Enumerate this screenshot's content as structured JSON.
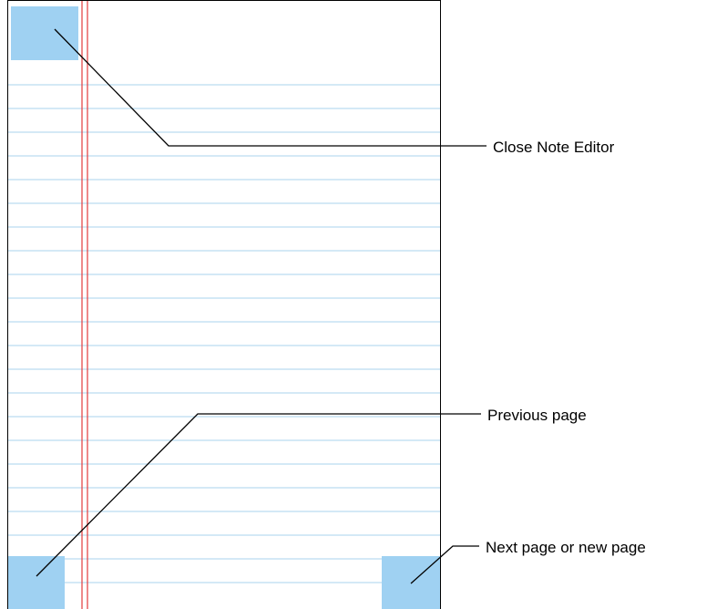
{
  "colors": {
    "page_border": "#000000",
    "rule_line": "#a9d3ee",
    "margin_line": "#e23b3b",
    "hotspot_fill": "#9fd1f2",
    "callout_line": "#000000"
  },
  "notepad": {
    "rule_count": 22
  },
  "callouts": {
    "close": {
      "label": "Close Note Editor"
    },
    "previous": {
      "label": "Previous page"
    },
    "next": {
      "label": "Next page or new page"
    }
  }
}
